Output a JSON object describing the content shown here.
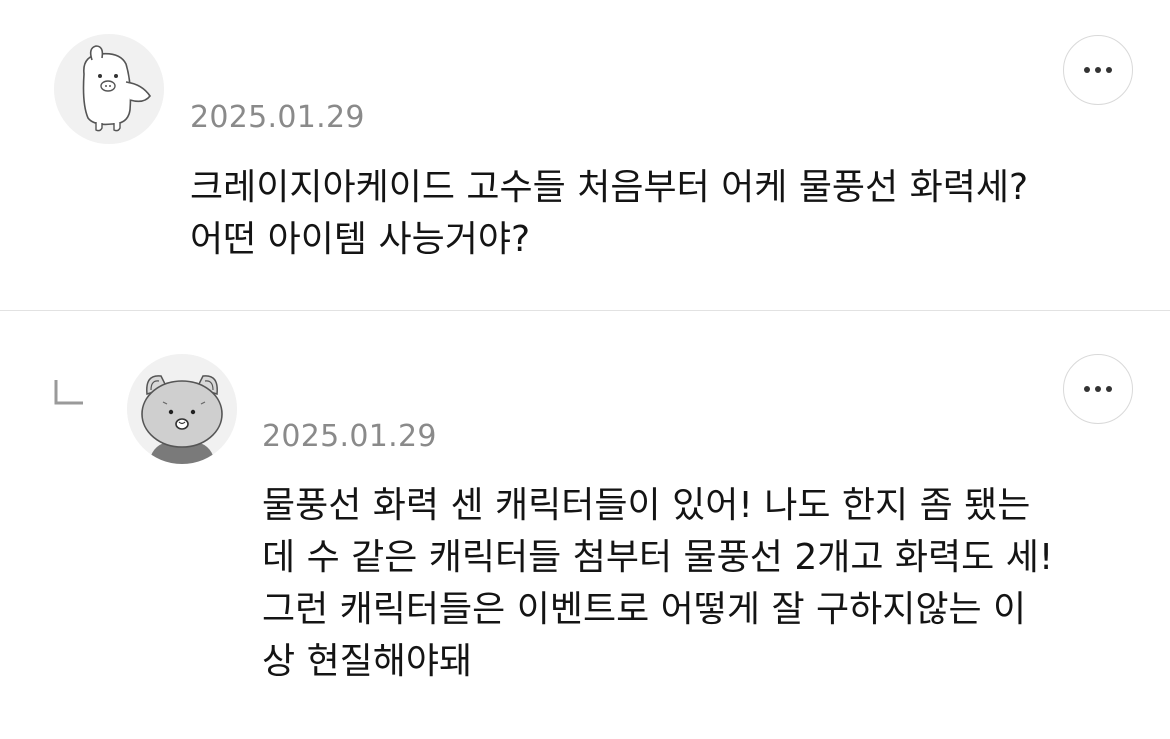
{
  "comments": [
    {
      "date": "2025.01.29",
      "text_lines": [
        "크레이지아케이드 고수들 처음부터 어케 물풍선 화력세?",
        "어떤 아이템 사능거야?"
      ],
      "avatar_icon": "bear-avatar-icon",
      "more_icon": "more-horizontal-icon"
    },
    {
      "date": "2025.01.29",
      "text_lines": [
        "물풍선 화력 센 캐릭터들이 있어! 나도 한지 좀 됐는",
        "데 수 같은 캐릭터들 첨부터 물풍선 2개고 화력도 세!",
        "그런 캐릭터들은 이벤트로 어떻게 잘 구하지않는 이",
        "상 현질해야돼"
      ],
      "avatar_icon": "cat-avatar-icon",
      "reply_icon": "reply-corner-icon",
      "more_icon": "more-horizontal-icon"
    }
  ],
  "colors": {
    "background": "#ffffff",
    "date": "#8a8a8a",
    "text": "#141414",
    "divider": "#e2e2e2",
    "avatar_bg": "#f1f1f1"
  }
}
